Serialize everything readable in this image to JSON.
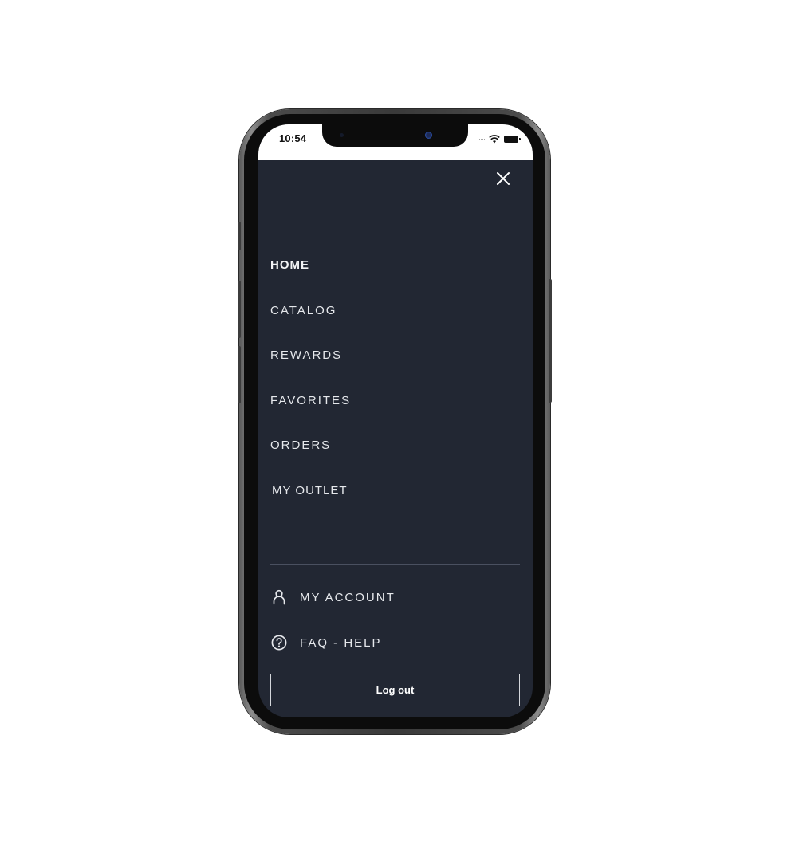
{
  "status_bar": {
    "time": "10:54",
    "signal_icon": "cellular-signal-icon",
    "wifi_icon": "wifi-icon",
    "battery_icon": "battery-icon"
  },
  "menu": {
    "close_icon": "close-icon",
    "items": [
      {
        "label": "HOME",
        "active": true
      },
      {
        "label": "CATALOG",
        "active": false
      },
      {
        "label": "REWARDS",
        "active": false
      },
      {
        "label": "FAVORITES",
        "active": false
      },
      {
        "label": "ORDERS",
        "active": false
      },
      {
        "label": "MY OUTLET",
        "active": false
      }
    ],
    "secondary": [
      {
        "label": "MY ACCOUNT",
        "icon": "user-icon"
      },
      {
        "label": "FAQ - HELP",
        "icon": "help-circle-icon"
      }
    ],
    "logout_label": "Log out"
  },
  "colors": {
    "menu_background": "#222733",
    "text": "#e6e8ec",
    "divider": "#4a5060",
    "logout_border": "#d4d6db"
  }
}
